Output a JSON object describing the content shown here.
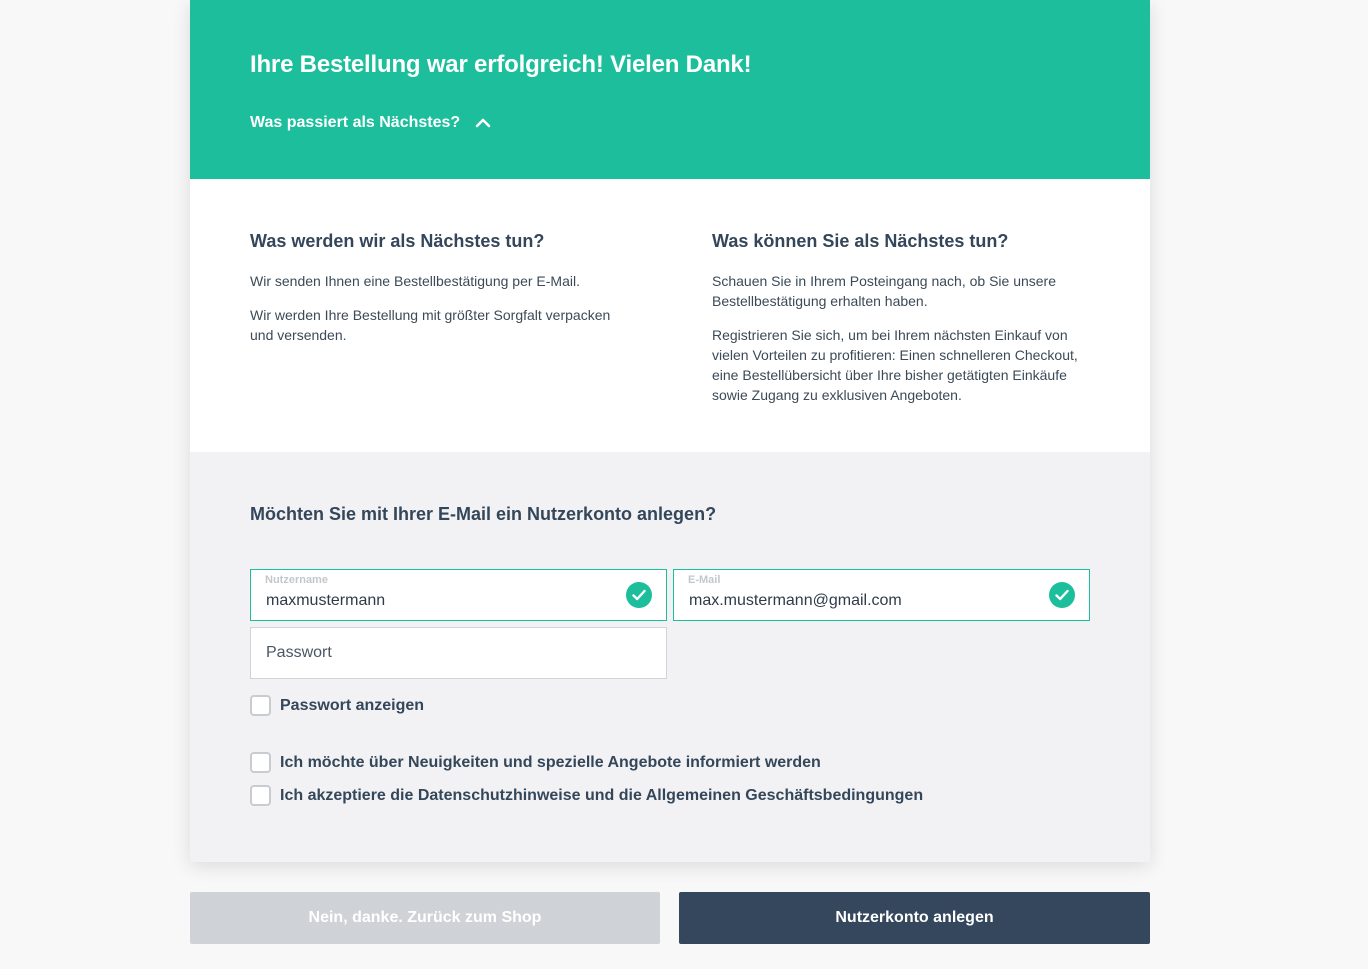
{
  "header": {
    "title": "Ihre Bestellung war erfolgreich! Vielen Dank!",
    "next_toggle_label": "Was passiert als Nächstes?",
    "toggle_icon": "chevron-up-icon",
    "background_color": "#1dbe9c"
  },
  "info": {
    "left": {
      "heading": "Was werden wir als Nächstes tun?",
      "paragraphs": [
        "Wir senden Ihnen eine Bestellbestätigung per E-Mail.",
        "Wir werden Ihre Bestellung mit größter Sorgfalt verpacken und versenden."
      ]
    },
    "right": {
      "heading": "Was können Sie als Nächstes tun?",
      "paragraphs": [
        "Schauen Sie in Ihrem Posteingang nach, ob Sie unsere Bestellbestätigung erhalten haben.",
        "Registrieren Sie sich, um bei Ihrem nächsten Einkauf von vielen Vorteilen zu profitieren: Einen schnelleren Checkout, eine Bestellübersicht über Ihre bisher getätigten Einkäufe sowie Zugang zu exklusiven Angeboten."
      ]
    }
  },
  "register": {
    "title": "Möchten Sie mit Ihrer E-Mail ein Nutzerkonto anlegen?",
    "username": {
      "label": "Nutzername",
      "value": "maxmustermann",
      "valid": true,
      "icon": "check-icon"
    },
    "email": {
      "label": "E-Mail",
      "value": "max.mustermann@gmail.com",
      "valid": true,
      "icon": "check-icon"
    },
    "password": {
      "placeholder": "Passwort",
      "value": ""
    },
    "show_password_label": "Passwort anzeigen",
    "newsletter_label": "Ich möchte über Neuigkeiten und spezielle Angebote informiert werden",
    "terms_label": "Ich akzeptiere die Datenschutzhinweise und die Allgemeinen Geschäftsbedingungen"
  },
  "buttons": {
    "back_label": "Nein, danke. Zurück zum Shop",
    "create_label": "Nutzerkonto anlegen"
  },
  "colors": {
    "accent": "#1dbe9c",
    "primary_button": "#35475d",
    "secondary_button": "#cfd3d7"
  }
}
